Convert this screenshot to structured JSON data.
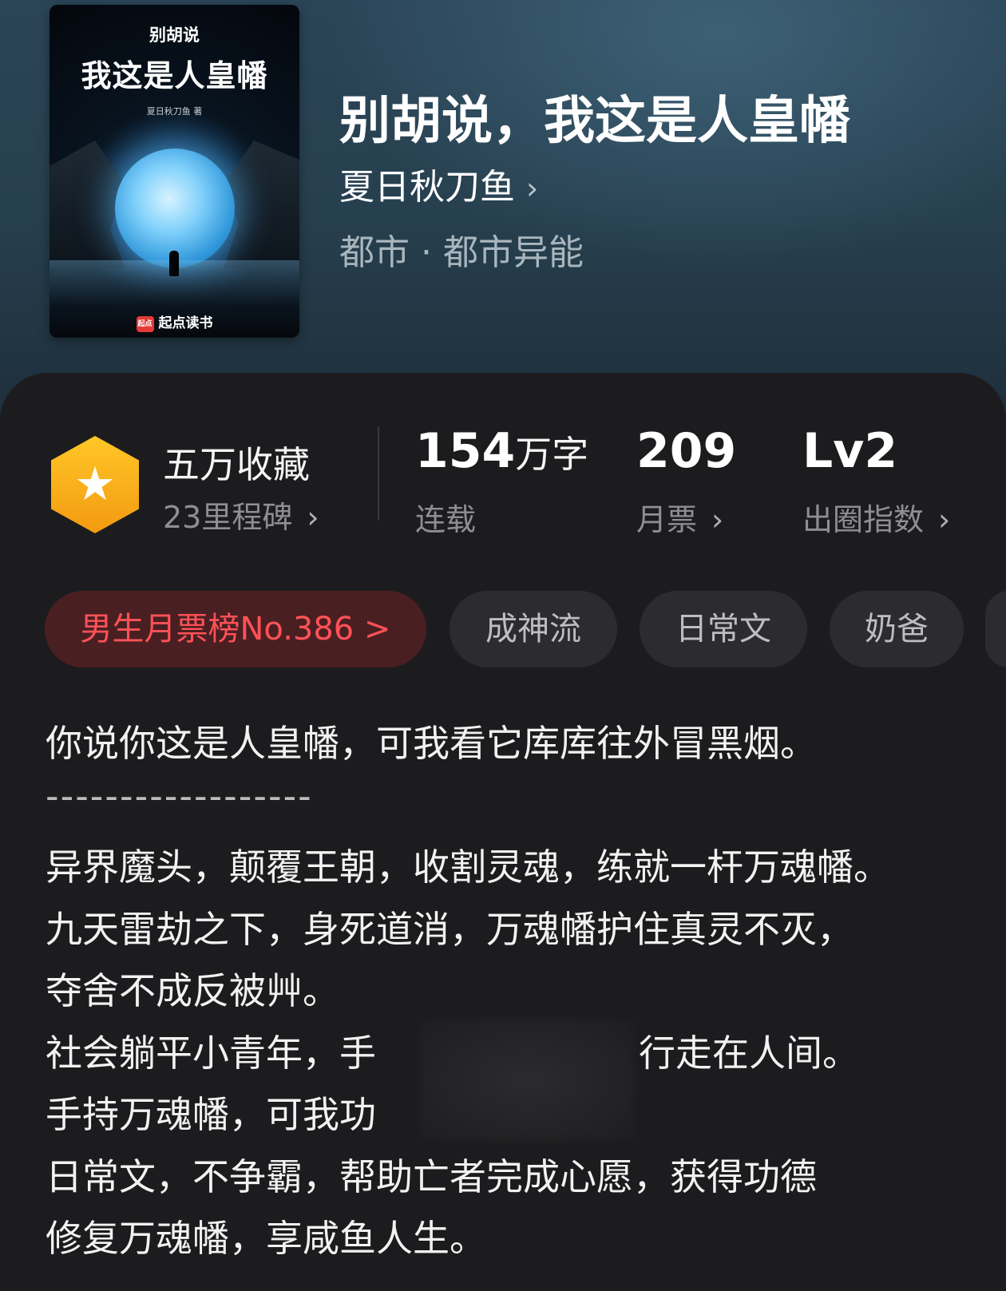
{
  "book": {
    "title": "别胡说，我这是人皇幡",
    "author": "夏日秋刀鱼",
    "author_chevron": "›",
    "genre": "都市 · 都市异能"
  },
  "cover": {
    "top_text": "别胡说",
    "title_text": "我这是人皇幡",
    "author_text": "夏日秋刀鱼 著",
    "brand_logo": "起点",
    "brand": "起点读书"
  },
  "stats": {
    "collection": {
      "label": "五万收藏",
      "sub": "23里程碑",
      "chevron": "›"
    },
    "words": {
      "value": "154",
      "unit": "万字",
      "sub": "连载"
    },
    "tickets": {
      "value": "209",
      "sub": "月票",
      "chevron": "›"
    },
    "level": {
      "value": "Lv2",
      "sub": "出圈指数",
      "chevron": "›"
    }
  },
  "tags": {
    "rank": "男生月票榜No.386 >",
    "items": [
      "成神流",
      "日常文",
      "奶爸"
    ]
  },
  "description": {
    "lines": [
      "你说你这是人皇幡，可我看它库库往外冒黑烟。",
      "------------------",
      "异界魔头，颠覆王朝，收割灵魂，练就一杆万魂幡。",
      "九天雷劫之下，身死道消，万魂幡护住真灵不灭，",
      "夺舍不成反被艸。",
      "社会躺平小青年，手",
      "手持万魂幡，可我功",
      "日常文，不争霸，帮助亡者完成心愿，获得功德",
      "修复万魂幡，享咸鱼人生。"
    ],
    "line6_tail": "行走在人间。"
  },
  "colors": {
    "header_bg": "#2b4557",
    "panel_bg": "#1c1c1e",
    "rank_tag_text": "#ff5257",
    "badge": "#f9b31a"
  },
  "icons": {
    "milestone_badge": "hexagon-star-icon",
    "chevron": "chevron-right-icon"
  }
}
